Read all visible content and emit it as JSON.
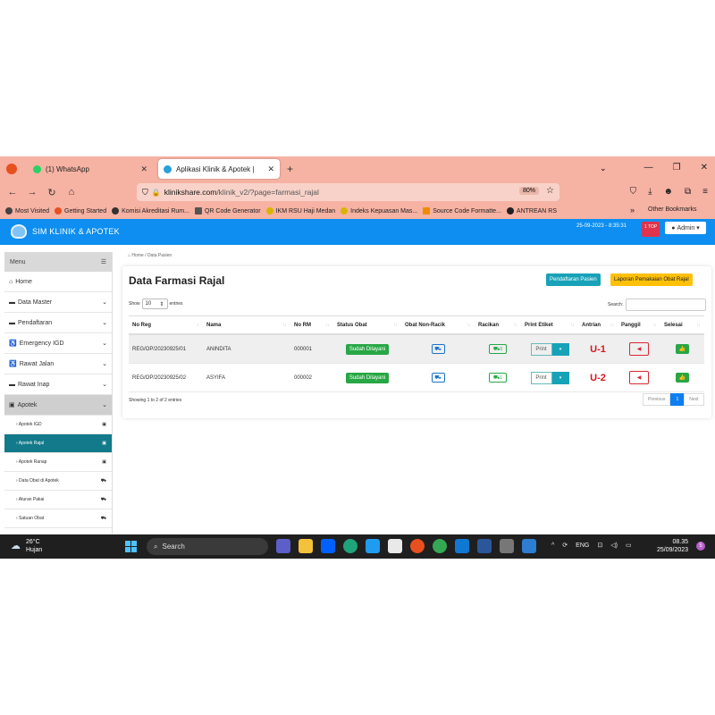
{
  "browser": {
    "tabs": [
      {
        "title": "(1) WhatsApp",
        "icon_color": "#25d366"
      },
      {
        "title": "Aplikasi Klinik & Apotek |",
        "icon_color": "#2aa1d8"
      }
    ],
    "url_host": "klinikshare.com",
    "url_path": "/klinik_v2/?page=farmasi_rajal",
    "zoom": "80%",
    "bookmarks": [
      {
        "label": "Most Visited",
        "icon_color": "#444"
      },
      {
        "label": "Getting Started",
        "icon_color": "#e8501f"
      },
      {
        "label": "Komisi Akreditasi Rum...",
        "icon_color": "#333"
      },
      {
        "label": "QR Code Generator",
        "icon_color": "#555"
      },
      {
        "label": "IKM RSU Haji Medan",
        "icon_color": "#d9b400"
      },
      {
        "label": "Indeks Kepuasan Mas...",
        "icon_color": "#d9b400"
      },
      {
        "label": "Source Code Formatte...",
        "icon_color": "#f08a00"
      },
      {
        "label": "ANTREAN RS",
        "icon_color": "#222"
      }
    ],
    "other_bookmarks": "Other Bookmarks"
  },
  "app": {
    "name": "SIM KLINIK & APOTEK",
    "datetime": "25-09-2023 - 8:35:31",
    "notif_count": "1 TOP",
    "user": "Admin"
  },
  "sidebar": {
    "menu_label": "Menu",
    "items": [
      {
        "label": "Home",
        "icon": "home-icon",
        "glyph": "⌂",
        "chevron": false
      },
      {
        "label": "Data Master",
        "icon": "folder-icon",
        "glyph": "▬",
        "chevron": true
      },
      {
        "label": "Pendaftaran",
        "icon": "folder-icon",
        "glyph": "▬",
        "chevron": true
      },
      {
        "label": "Emergency IGD",
        "icon": "wheelchair-icon",
        "glyph": "♿",
        "chevron": true
      },
      {
        "label": "Rawat Jalan",
        "icon": "wheelchair-icon",
        "glyph": "♿",
        "chevron": true
      },
      {
        "label": "Rawat Inap",
        "icon": "bed-icon",
        "glyph": "▬",
        "chevron": true
      },
      {
        "label": "Apotek",
        "icon": "medkit-icon",
        "glyph": "▣",
        "chevron": true
      }
    ],
    "sub_items": [
      {
        "label": "› Apotek IGD",
        "icon": "medkit-icon",
        "active": false
      },
      {
        "label": "› Apotek Rajal",
        "icon": "medkit-icon",
        "active": true
      },
      {
        "label": "› Apotek Ranap",
        "icon": "medkit-icon",
        "active": false
      },
      {
        "label": "› Data Obat di Apotek",
        "icon": "pills-icon",
        "active": false
      },
      {
        "label": "› Aturan Pakai",
        "icon": "pills-icon",
        "active": false
      },
      {
        "label": "› Satuan Obat",
        "icon": "pills-icon",
        "active": false
      }
    ]
  },
  "breadcrumb": {
    "home": "Home",
    "current": "Data Pasien"
  },
  "page": {
    "title": "Data Farmasi Rajal",
    "btn_pendaftaran": "Pendaftaran Pasien",
    "btn_laporan": "Laporan Pemakaian Obat Rajal",
    "show_label": "Show",
    "entries_label": "entries",
    "show_value": "10",
    "search_label": "Search:",
    "showing": "Showing 1 to 2 of 2 entries",
    "pager": {
      "prev": "Previous",
      "page": "1",
      "next": "Next"
    }
  },
  "table": {
    "headers": [
      "No Reg",
      "Nama",
      "No RM",
      "Status Obat",
      "Obat Non-Racik",
      "Racikan",
      "Print Etiket",
      "Antrian",
      "Panggil",
      "Selesai"
    ],
    "rows": [
      {
        "no_reg": "REG/OP/20230925/01",
        "nama": "ANINDITA",
        "no_rm": "000001",
        "status": "Sudah Dilayani",
        "racikan_count": "0",
        "print": "Print",
        "antrian": "U-1"
      },
      {
        "no_reg": "REG/OP/20230925/02",
        "nama": "ASYIFA",
        "no_rm": "000002",
        "status": "Sudah Dilayani",
        "racikan_count": "1",
        "print": "Print",
        "antrian": "U-2"
      }
    ]
  },
  "taskbar": {
    "temp": "26°C",
    "weather": "Hujan",
    "search": "Search",
    "lang": "ENG",
    "time": "08.35",
    "date": "25/09/2023",
    "notif": "5"
  }
}
